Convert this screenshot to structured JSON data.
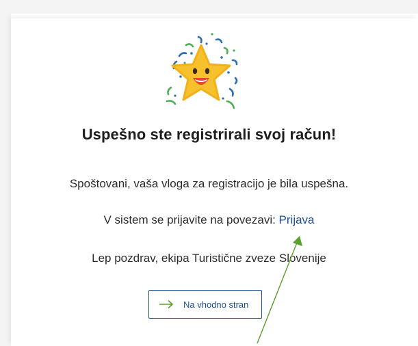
{
  "heading": "Uspešno ste registrirali svoj račun!",
  "message": {
    "greeting": "Spoštovani, vaša vloga za registracijo je bila uspešna.",
    "login_prefix": "V sistem se prijavite na povezavi: ",
    "login_link": "Prijava",
    "signoff": "Lep pozdrav, ekipa Turistične zveze Slovenije"
  },
  "home_button": {
    "label": "Na vhodno stran",
    "icon": "arrow-right-icon"
  },
  "illustration": {
    "icon": "smiling-star-confetti-icon"
  },
  "colors": {
    "link": "#1b4f99",
    "star": "#f6c12c",
    "annotation": "#5aa02c"
  }
}
